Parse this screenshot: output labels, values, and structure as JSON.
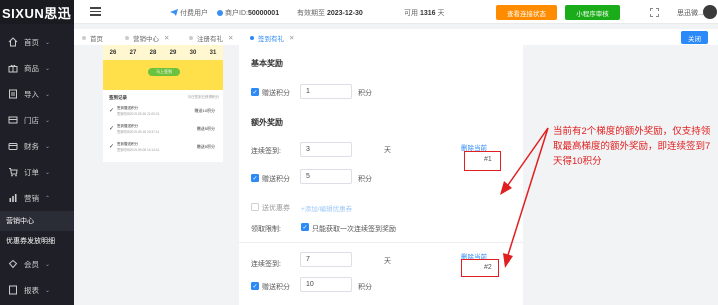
{
  "logo": "SIXUN思迅",
  "sidebar": {
    "items": [
      {
        "label": "首页",
        "icon": "home-icon"
      },
      {
        "label": "商品",
        "icon": "gift-icon"
      },
      {
        "label": "导入",
        "icon": "import-icon"
      },
      {
        "label": "门店",
        "icon": "store-icon"
      },
      {
        "label": "财务",
        "icon": "wallet-icon"
      },
      {
        "label": "订单",
        "icon": "order-icon"
      },
      {
        "label": "营销",
        "icon": "marketing-icon"
      }
    ],
    "subitems": [
      "营销中心",
      "优惠券发放明细"
    ],
    "more": [
      {
        "label": "会员",
        "icon": "member-icon"
      },
      {
        "label": "报表",
        "icon": "report-icon"
      }
    ]
  },
  "header": {
    "paid_user": "付费用户",
    "merchant_label": "商户ID:",
    "merchant_id": "50000001",
    "expire_label": "有效期至",
    "expire_date": "2023-12-30",
    "days_label": "可用",
    "days": "1316",
    "days_unit": "天",
    "btn_link_status": "查看连接状态",
    "btn_miniapp": "小程序审核",
    "user": "思迅微..."
  },
  "tabs": [
    {
      "label": "首页",
      "active": false
    },
    {
      "label": "营销中心",
      "active": false
    },
    {
      "label": "注册有礼",
      "active": false
    },
    {
      "label": "签到有礼",
      "active": true
    }
  ],
  "close_label": "关闭",
  "phone": {
    "dates": [
      "26",
      "27",
      "28",
      "29",
      "30",
      "31"
    ],
    "sign_btn": "马上签到",
    "records_title": "签到记录",
    "records_sub": "今日签到已获得积分",
    "rows": [
      {
        "t1": "签到赠送积分",
        "t2": "签到时间2019-09-26 21:00:01",
        "pts": "赠送10积分"
      },
      {
        "t1": "签到赠送积分",
        "t2": "签到时间2019-09-18 20:37:11",
        "pts": "赠送5积分"
      },
      {
        "t1": "签到赠送积分",
        "t2": "签到时间2019-09-08 14:14:41",
        "pts": "赠送5积分"
      }
    ]
  },
  "form": {
    "basic_title": "基本奖励",
    "give_points": "赠送积分",
    "basic_points": "1",
    "points_unit": "积分",
    "extra_title": "额外奖励",
    "consec_label": "连续签到:",
    "tier1_days": "3",
    "day_unit": "天",
    "delete_label": "删除当前",
    "tier1_index": "#1",
    "tier1_points": "5",
    "coupon_label": "送优惠券",
    "add_coupon": "+添加/编辑优惠券",
    "limit_label": "领取限制:",
    "limit_text": "只能获取一次连续签到奖励",
    "tier2_days": "7",
    "tier2_index": "#2",
    "tier2_points": "10"
  },
  "annotation": "当前有2个梯度的额外奖励，仅支持领取最高梯度的额外奖励，即连续签到7天得10积分",
  "colors": {
    "accent": "#2b8af7",
    "annotation": "#e02020",
    "orange": "#ff8c00",
    "green": "#1aad19"
  }
}
